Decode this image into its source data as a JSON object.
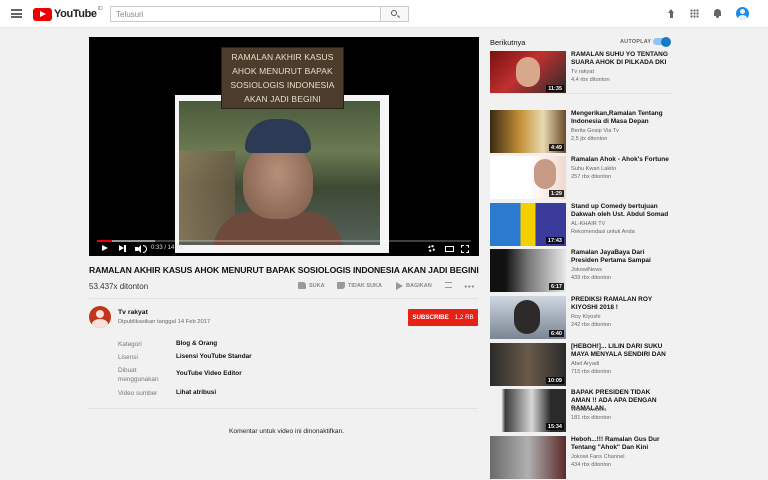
{
  "header": {
    "logo_text": "YouTube",
    "logo_sup": "ID",
    "search_placeholder": "Telusuri"
  },
  "player": {
    "caption": "RAMALAN AKHIR KASUS AHOK MENURUT BAPAK SOSIOLOGIS INDONESIA AKAN JADI BEGINI",
    "time": "0:33 / 14:01",
    "progress_fraction": 0.039
  },
  "video": {
    "title": "RAMALAN AKHIR KASUS AHOK MENURUT BAPAK SOSIOLOGIS INDONESIA AKAN JADI BEGINI",
    "views": "53.437x ditonton",
    "like_label": "SUKA",
    "dislike_label": "TIDAK SUKA",
    "share_label": "BAGIKAN"
  },
  "channel": {
    "name": "Tv rakyat",
    "published": "Dipublikasikan tanggal 14 Feb 2017",
    "subscribe_label": "SUBSCRIBE",
    "subscriber_count": "1,2 RB"
  },
  "meta": [
    {
      "key": "Kategori",
      "value": "Blog & Orang"
    },
    {
      "key": "Lisensi",
      "value": "Lisensi YouTube Standar"
    },
    {
      "key": "Dibuat menggunakan",
      "value": "YouTube Video Editor"
    },
    {
      "key": "Video sumber",
      "value": "Lihat atribusi"
    }
  ],
  "comments_disabled": "Komentar untuk video ini dinonaktifkan.",
  "sidebar": {
    "up_next": "Berikutnya",
    "autoplay": "AUTOPLAY",
    "autoplay_on": true,
    "items": [
      {
        "title": "RAMALAN SUHU YO TENTANG SUARA AHOK DI PILKADA DKI",
        "channel": "Tv rakyat",
        "views": "4,4 rbx ditonton",
        "duration": "11:35"
      },
      {
        "title": "Mengerikan,Ramalan Tentang Indonesia di Masa Depan",
        "channel": "Berita Gosip Via Tv",
        "views": "2,5 jtx ditonton",
        "duration": "4:49"
      },
      {
        "title": "Ramalan Ahok - Ahok's Fortune",
        "channel": "Suhu Kwan Lakito",
        "views": "257 rbx ditonton",
        "duration": "1:29"
      },
      {
        "title": "Stand up Comedy bertujuan Dakwah oleh Ust. Abdul Somad",
        "channel": "AL-KHAIR TV",
        "views": "Rekomendasi untuk Anda",
        "duration": "17:43"
      },
      {
        "title": "Ramalan JayaBaya Dari Presiden Pertama Sampai",
        "channel": "JokowiNews",
        "views": "439 rbx ditonton",
        "duration": "6:17"
      },
      {
        "title": "PREDIKSI RAMALAN ROY KIYOSHI 2018 !",
        "channel": "Roy Kiyoshi",
        "views": "242 rbx ditonton",
        "duration": "6:40"
      },
      {
        "title": "[HEBOH!]... LILIN DARI SUKU MAYA MENYALA SENDIRI DAN",
        "channel": "Abel Aryadi",
        "views": "715 rbx ditonton",
        "duration": "10:09"
      },
      {
        "title": "BAPAK PRESIDEN TIDAK AMAN !! ADA APA DENGAN RAMALAN",
        "channel": "Willedravastra",
        "views": "181 rbx ditonton",
        "duration": "15:34"
      },
      {
        "title": "Heboh...!!! Ramalan Gus Dur Tentang \"Ahok\" Dan Kini",
        "channel": "Jokowi Fans Channel",
        "views": "434 rbx ditonton",
        "duration": ""
      }
    ]
  }
}
